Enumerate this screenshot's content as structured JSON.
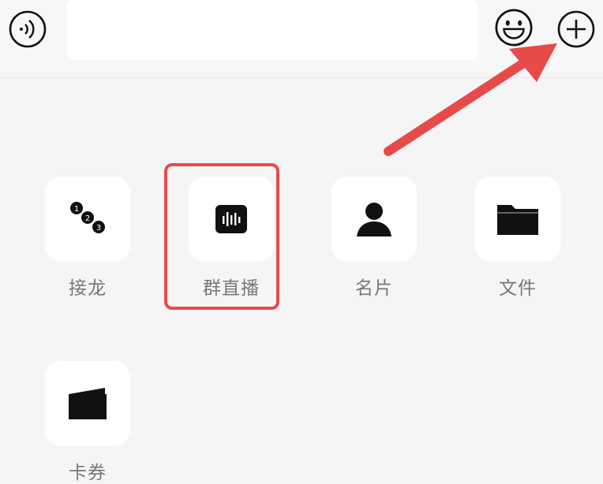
{
  "input": {
    "value": ""
  },
  "panel": {
    "items": [
      {
        "label": "接龙",
        "icon": "solitaire-numbers-icon"
      },
      {
        "label": "群直播",
        "icon": "live-stream-icon"
      },
      {
        "label": "名片",
        "icon": "contact-card-person-icon"
      },
      {
        "label": "文件",
        "icon": "folder-icon"
      },
      {
        "label": "卡券",
        "icon": "wallet-card-icon"
      }
    ]
  },
  "colors": {
    "annotation": "#e84a4a",
    "icon": "#111111",
    "label": "#777777"
  },
  "toolbar_icons": [
    "voice-input-icon",
    "emoji-icon",
    "plus-circle-icon"
  ]
}
